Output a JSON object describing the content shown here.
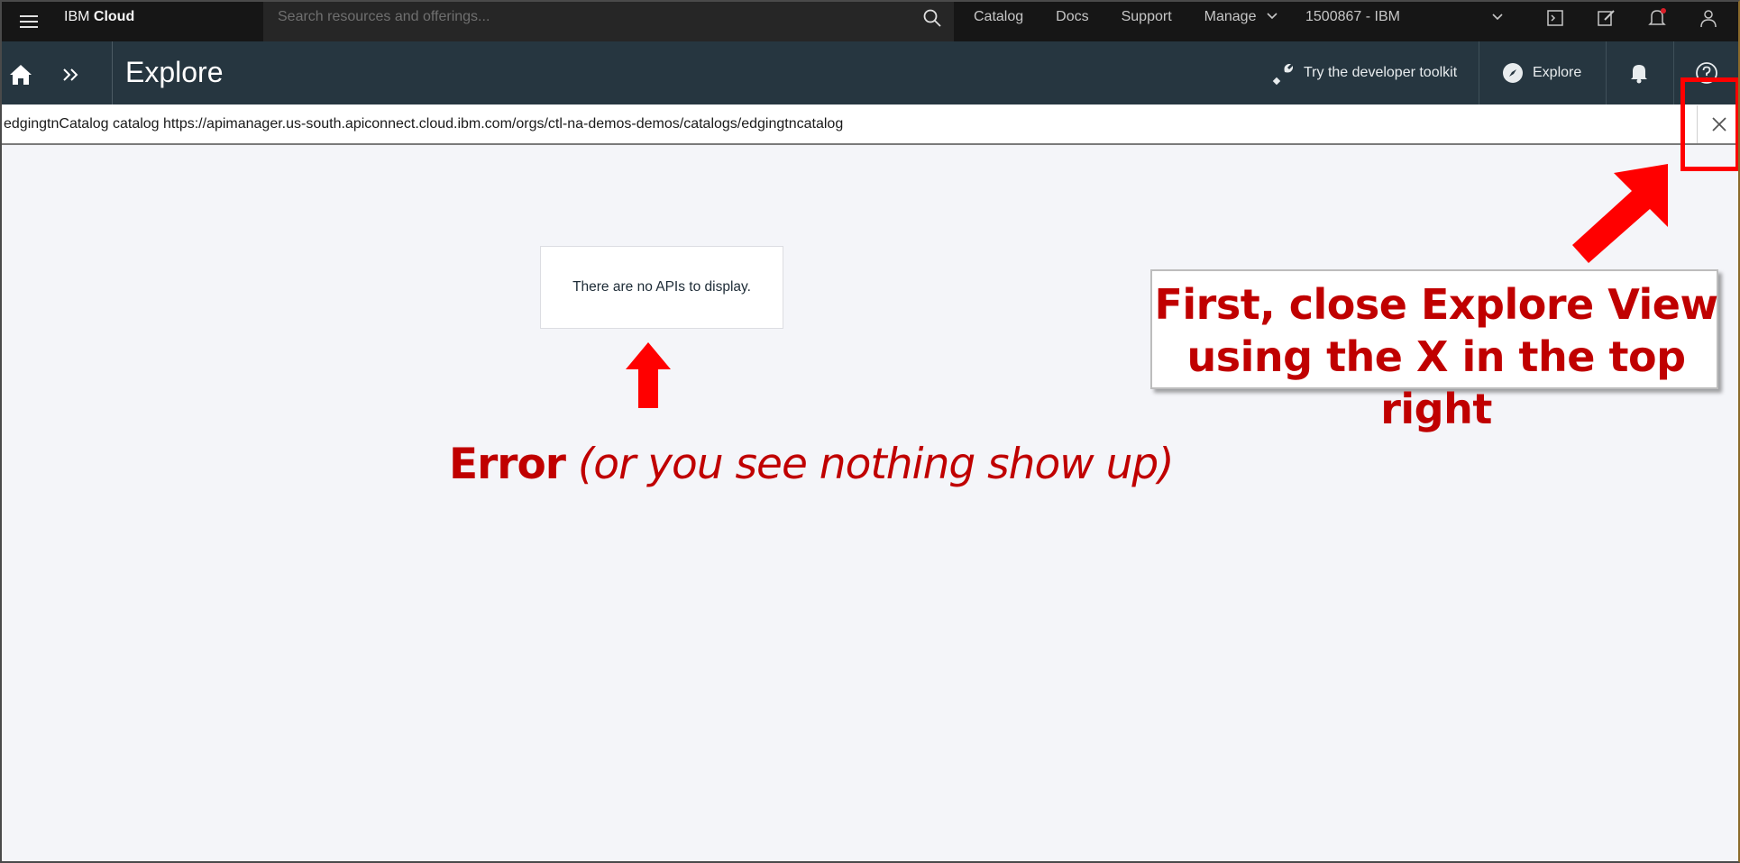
{
  "topbar": {
    "brand_prefix": "IBM",
    "brand_suffix": "Cloud",
    "search_placeholder": "Search resources and offerings...",
    "nav": [
      "Catalog",
      "Docs",
      "Support",
      "Manage"
    ],
    "account": "1500867 - IBM"
  },
  "subbar": {
    "title": "Explore",
    "toolkit_label": "Try the developer toolkit",
    "explore_label": "Explore"
  },
  "urlbar": {
    "text": "edgingtnCatalog catalog https://apimanager.us-south.apiconnect.cloud.ibm.com/orgs/ctl-na-demos-demos/catalogs/edgingtncatalog"
  },
  "content": {
    "empty_message": "There are no APIs to display."
  },
  "annotations": {
    "error_bold": "Error",
    "error_italic": "(or you see nothing show up)",
    "callout_line1": "First, close Explore View",
    "callout_line2": "using the X in the top right"
  },
  "colors": {
    "topbar_bg": "#161616",
    "subbar_bg": "#263640",
    "annotation_red": "#c00000",
    "highlight_red": "#ff0000"
  }
}
